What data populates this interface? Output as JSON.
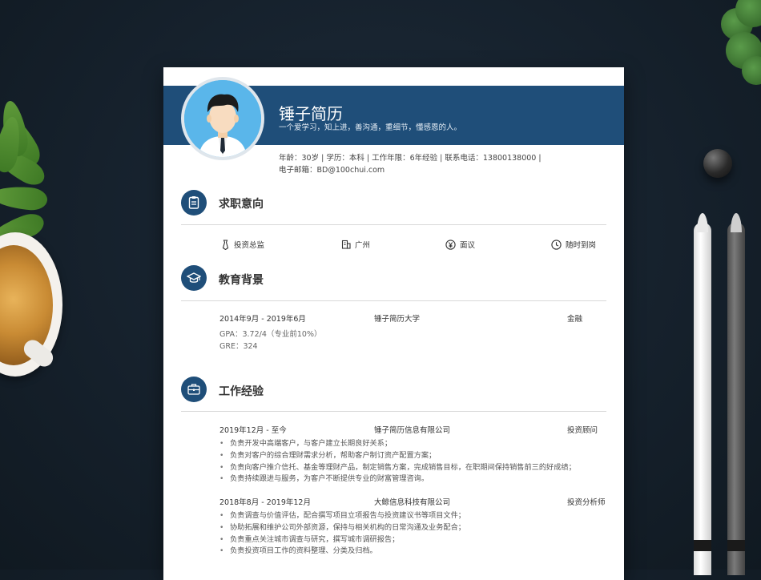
{
  "resume": {
    "name": "锤子简历",
    "motto": "一个爱学习，知上进，善沟通，重细节，懂感恩的人。",
    "info_line1": "年龄：30岁 | 学历：本科 | 工作年限：6年经验 | 联系电话：13800138000 |",
    "info_line2": "电子邮箱：BD@100chui.com"
  },
  "sections": {
    "intent": {
      "title": "求职意向",
      "icon": "clipboard-icon",
      "items": [
        {
          "icon": "tie-icon",
          "label": "投资总监"
        },
        {
          "icon": "building-icon",
          "label": "广州"
        },
        {
          "icon": "yen-icon",
          "label": "面议"
        },
        {
          "icon": "clock-icon",
          "label": "随时到岗"
        }
      ]
    },
    "education": {
      "title": "教育背景",
      "icon": "graduation-cap-icon",
      "period": "2014年9月 - 2019年6月",
      "school": "锤子简历大学",
      "major": "金融",
      "details": [
        "GPA：3.72/4（专业前10%）",
        "GRE：324"
      ]
    },
    "work": {
      "title": "工作经验",
      "icon": "briefcase-icon",
      "jobs": [
        {
          "period": "2019年12月 - 至今",
          "company": "锤子简历信息有限公司",
          "role": "投资顾问",
          "duties": [
            "负责开发中高端客户，与客户建立长期良好关系；",
            "负责对客户的综合理财需求分析，帮助客户制订资产配置方案；",
            "负责向客户推介信托、基金等理财产品，制定销售方案，完成销售目标，在职期间保持销售前三的好成绩；",
            "负责持续跟进与服务，为客户不断提供专业的财富管理咨询。"
          ]
        },
        {
          "period": "2018年8月 - 2019年12月",
          "company": "大鲸信息科技有限公司",
          "role": "投资分析师",
          "duties": [
            "负责调查与价值评估，配合撰写项目立项报告与投资建议书等项目文件；",
            "协助拓展和维护公司外部资源，保持与相关机构的日常沟通及业务配合；",
            "负责重点关注城市调查与研究，撰写城市调研报告；",
            "负责投资项目工作的资料整理、分类及归档。"
          ]
        }
      ]
    }
  },
  "colors": {
    "accent": "#1f4e79",
    "background": "#16222e",
    "avatar_bg": "#5ab6ea"
  }
}
